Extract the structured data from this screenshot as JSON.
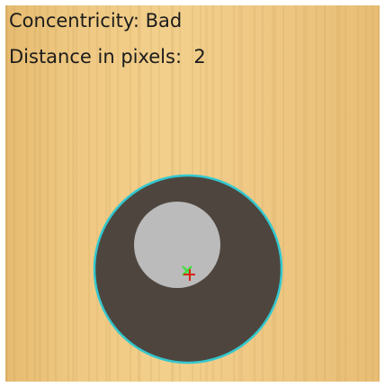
{
  "status": {
    "concentricity_label": "Concentricity:",
    "concentricity_value": "Bad",
    "distance_label": "Distance in pixels:",
    "distance_value": "2"
  },
  "colors": {
    "outer_circle": "#4e463e",
    "outer_outline": "#32c8d0",
    "inner_circle": "#bbbbbb",
    "inner_center_marker": "#44dd44",
    "outer_center_marker": "#dd2211",
    "background": "#efc983"
  },
  "icons": {
    "inner_center_marker": "x-cross-icon",
    "outer_center_marker": "plus-cross-icon"
  }
}
